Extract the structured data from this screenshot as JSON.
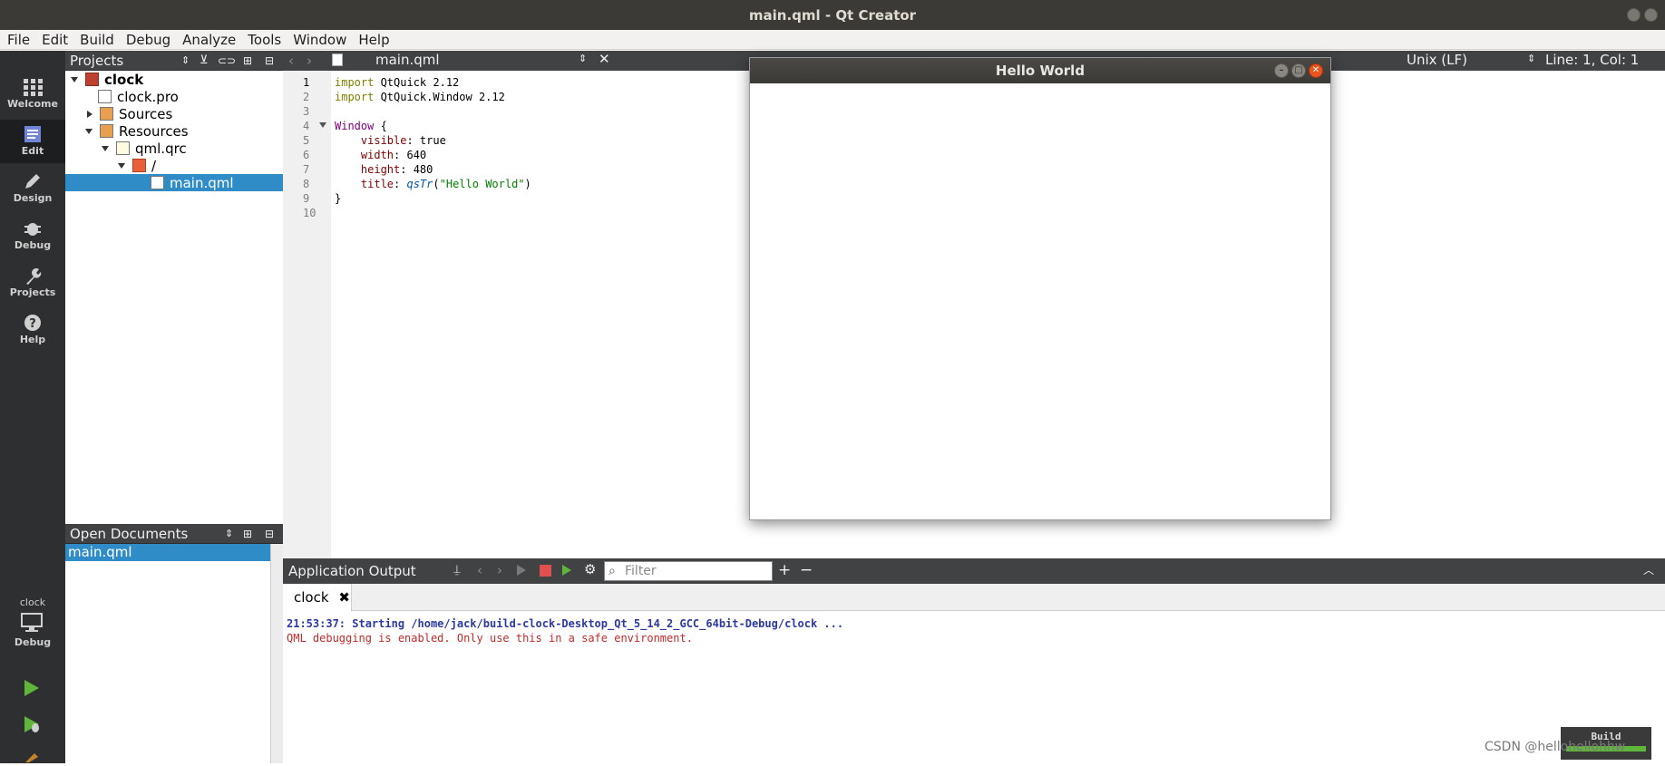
{
  "window": {
    "title": "main.qml - Qt Creator"
  },
  "menu": [
    "File",
    "Edit",
    "Build",
    "Debug",
    "Analyze",
    "Tools",
    "Window",
    "Help"
  ],
  "modes": [
    {
      "label": "Welcome",
      "icon": "grid-icon"
    },
    {
      "label": "Edit",
      "icon": "edit-doc-icon"
    },
    {
      "label": "Design",
      "icon": "pencil-icon"
    },
    {
      "label": "Debug",
      "icon": "bug-icon"
    },
    {
      "label": "Projects",
      "icon": "wrench-icon"
    },
    {
      "label": "Help",
      "icon": "help-icon"
    }
  ],
  "kit": {
    "project": "clock",
    "mode": "Debug"
  },
  "projects": {
    "header": "Projects",
    "tree": [
      {
        "label": "clock"
      },
      {
        "label": "clock.pro"
      },
      {
        "label": "Sources"
      },
      {
        "label": "Resources"
      },
      {
        "label": "qml.qrc"
      },
      {
        "label": "/"
      },
      {
        "label": "main.qml"
      }
    ]
  },
  "open_documents": {
    "header": "Open Documents",
    "items": [
      "main.qml"
    ]
  },
  "editor": {
    "file": "main.qml",
    "line_ending": "Unix (LF)",
    "cursor": "Line: 1, Col: 1",
    "line_numbers": [
      "1",
      "2",
      "3",
      "4",
      "5",
      "6",
      "7",
      "8",
      "9",
      "10"
    ]
  },
  "code": {
    "l1_kw": "import",
    "l1_rest": " QtQuick 2.12",
    "l2_kw": "import",
    "l2_rest": " QtQuick.Window 2.12",
    "l4_type": "Window",
    "l4_rest": " {",
    "l5_prop": "    visible",
    "l5_rest": ": true",
    "l6_prop": "    width",
    "l6_rest": ": 640",
    "l7_prop": "    height",
    "l7_rest": ": 480",
    "l8_prop": "    title",
    "l8_sep": ": ",
    "l8_fn": "qsTr",
    "l8_open": "(",
    "l8_str": "\"Hello World\"",
    "l8_close": ")",
    "l9": "}"
  },
  "hello_window": {
    "title": "Hello World"
  },
  "output": {
    "header": "Application Output",
    "filter_placeholder": "Filter",
    "tab": "clock",
    "line1": "21:53:37: Starting /home/jack/build-clock-Desktop_Qt_5_14_2_GCC_64bit-Debug/clock ...",
    "line2": "QML debugging is enabled. Only use this in a safe environment."
  },
  "status": {
    "build_label": "Build",
    "watermark": "CSDN @hellohellohhw"
  },
  "colors": {
    "selection": "#308cc6",
    "panel": "#404244",
    "modebar": "#2e2f30",
    "run_green": "#5fb63b"
  }
}
